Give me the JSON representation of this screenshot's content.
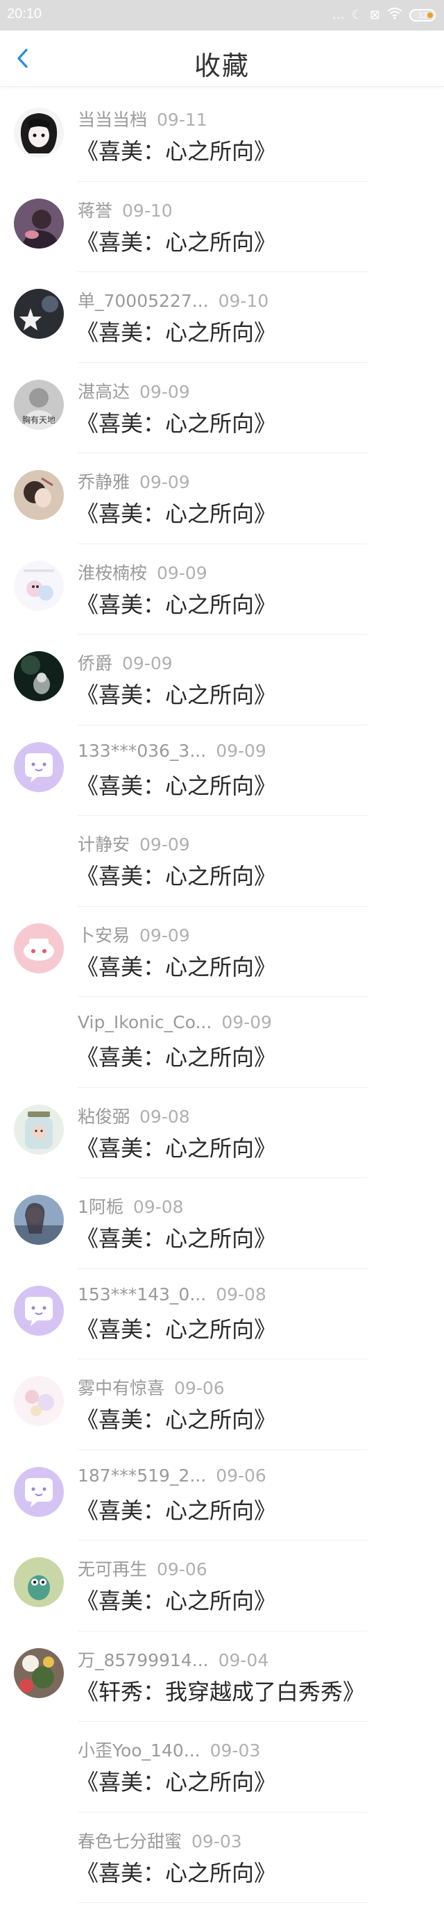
{
  "status_bar": {
    "time": "20:10",
    "battery": "32"
  },
  "header": {
    "title": "收藏"
  },
  "items": [
    {
      "name": "当当当档",
      "date": "09-11",
      "book": "《喜美：心之所向》",
      "avatar": "dark-girl"
    },
    {
      "name": "蒋誉",
      "date": "09-10",
      "book": "《喜美：心之所向》",
      "avatar": "photo-purple"
    },
    {
      "name": "单_70005227...",
      "date": "09-10",
      "book": "《喜美：心之所向》",
      "avatar": "photo-dark"
    },
    {
      "name": "湛高达",
      "date": "09-09",
      "book": "《喜美：心之所向》",
      "avatar": "photo-gray"
    },
    {
      "name": "乔静雅",
      "date": "09-09",
      "book": "《喜美：心之所向》",
      "avatar": "photo-beige"
    },
    {
      "name": "淮桉楠桉",
      "date": "09-09",
      "book": "《喜美：心之所向》",
      "avatar": "photo-cartoon"
    },
    {
      "name": "侨爵",
      "date": "09-09",
      "book": "《喜美：心之所向》",
      "avatar": "photo-night"
    },
    {
      "name": "133***036_3...",
      "date": "09-09",
      "book": "《喜美：心之所向》",
      "avatar": "default-chat"
    },
    {
      "name": "计静安",
      "date": "09-09",
      "book": "《喜美：心之所向》",
      "avatar": "none"
    },
    {
      "name": "卜安易",
      "date": "09-09",
      "book": "《喜美：心之所向》",
      "avatar": "pink-face"
    },
    {
      "name": "Vip_Ikonic_Co...",
      "date": "09-09",
      "book": "《喜美：心之所向》",
      "avatar": "none"
    },
    {
      "name": "粘俊弼",
      "date": "09-08",
      "book": "《喜美：心之所向》",
      "avatar": "photo-jar"
    },
    {
      "name": "1阿栀",
      "date": "09-08",
      "book": "《喜美：心之所向》",
      "avatar": "photo-blue"
    },
    {
      "name": "153***143_0...",
      "date": "09-08",
      "book": "《喜美：心之所向》",
      "avatar": "default-chat"
    },
    {
      "name": "雾中有惊喜",
      "date": "09-06",
      "book": "《喜美：心之所向》",
      "avatar": "photo-pastel"
    },
    {
      "name": "187***519_2...",
      "date": "09-06",
      "book": "《喜美：心之所向》",
      "avatar": "default-chat"
    },
    {
      "name": "无可再生",
      "date": "09-06",
      "book": "《喜美：心之所向》",
      "avatar": "photo-green"
    },
    {
      "name": "万_85799914...",
      "date": "09-04",
      "book": "《轩秀：我穿越成了白秀秀》",
      "avatar": "photo-toy"
    },
    {
      "name": "小歪Yoo_140...",
      "date": "09-03",
      "book": "《喜美：心之所向》",
      "avatar": "none"
    },
    {
      "name": "春色七分甜蜜",
      "date": "09-03",
      "book": "《喜美：心之所向》",
      "avatar": "none"
    }
  ]
}
